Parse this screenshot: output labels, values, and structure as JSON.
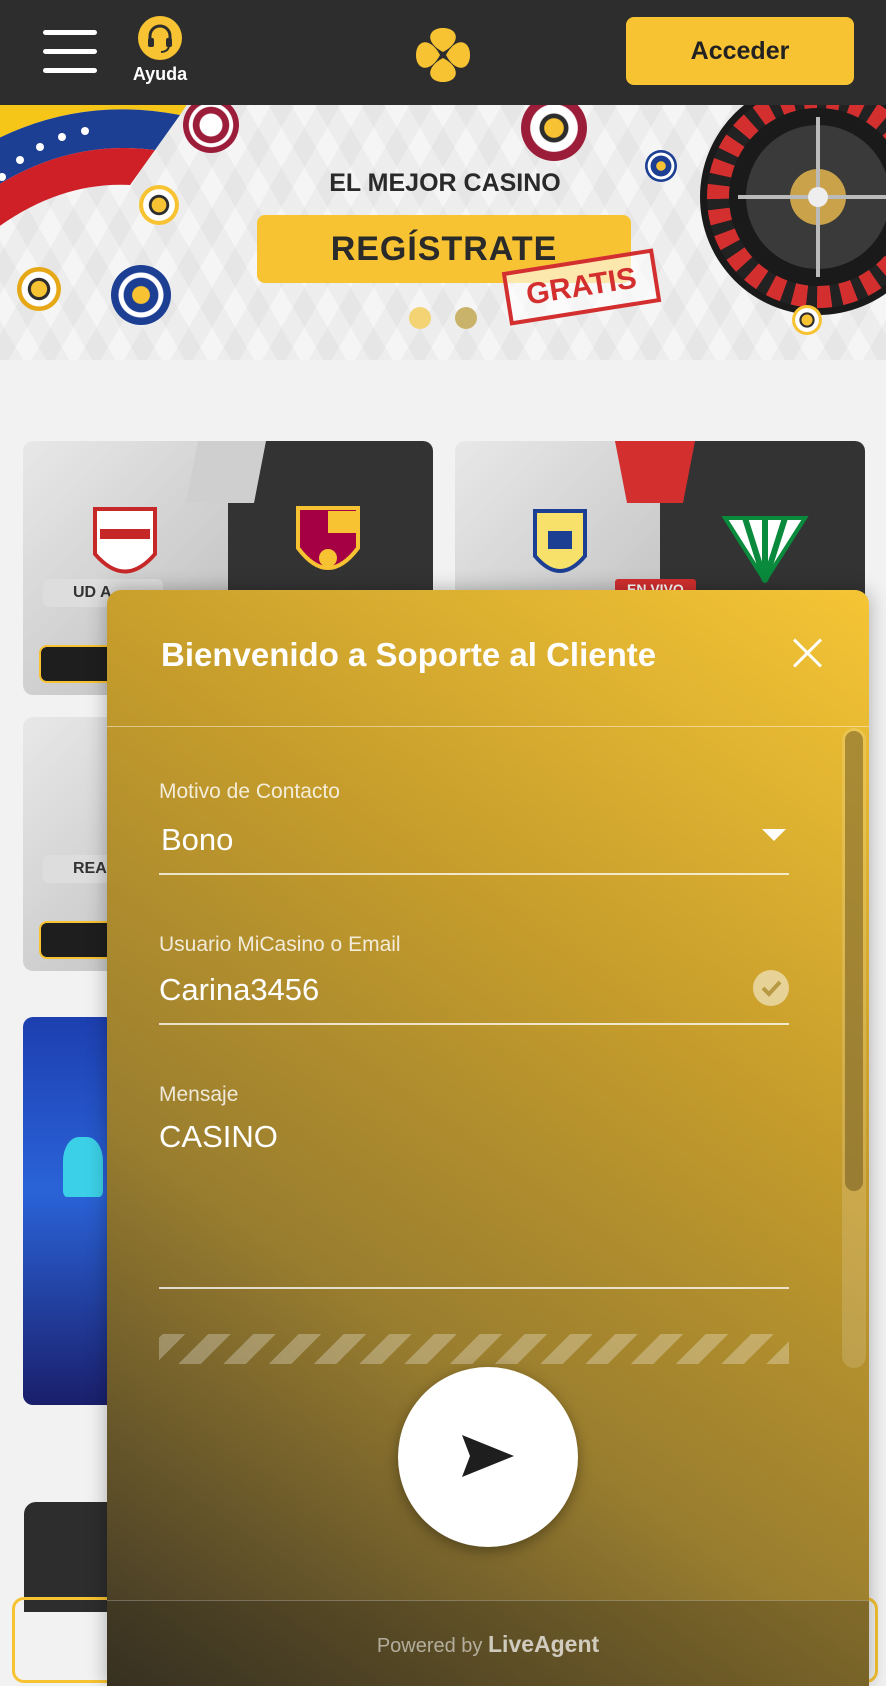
{
  "header": {
    "help_label": "Ayuda",
    "login_label": "Acceder",
    "accent_color": "#f7c332",
    "bar_color": "#2d2d2d"
  },
  "banner": {
    "heading": "EL MEJOR CASINO",
    "cta_label": "REGÍSTRATE",
    "stamp": "GRATIS",
    "slides_total": 2,
    "active_slide": 1
  },
  "matches": [
    {
      "home_short": "UD A",
      "badge_live": ""
    },
    {
      "home_short": "",
      "badge_live": "EN VIVO"
    },
    {
      "home_short": "REAL",
      "badge_live": ""
    }
  ],
  "chat": {
    "title": "Bienvenido a Soporte al Cliente",
    "fields": {
      "reason_label": "Motivo de Contacto",
      "reason_value": "Bono",
      "user_label": "Usuario MiCasino o Email",
      "user_value": "Carina3456",
      "message_label": "Mensaje",
      "message_value": "CASINO"
    },
    "footer_prefix": "Powered by",
    "footer_brand": "LiveAgent"
  },
  "icons": {
    "menu": "hamburger-icon",
    "help": "headset-icon",
    "logo": "clover-logo",
    "close": "close-icon",
    "dropdown": "caret-down-icon",
    "valid": "check-circle-icon",
    "send": "send-icon"
  }
}
